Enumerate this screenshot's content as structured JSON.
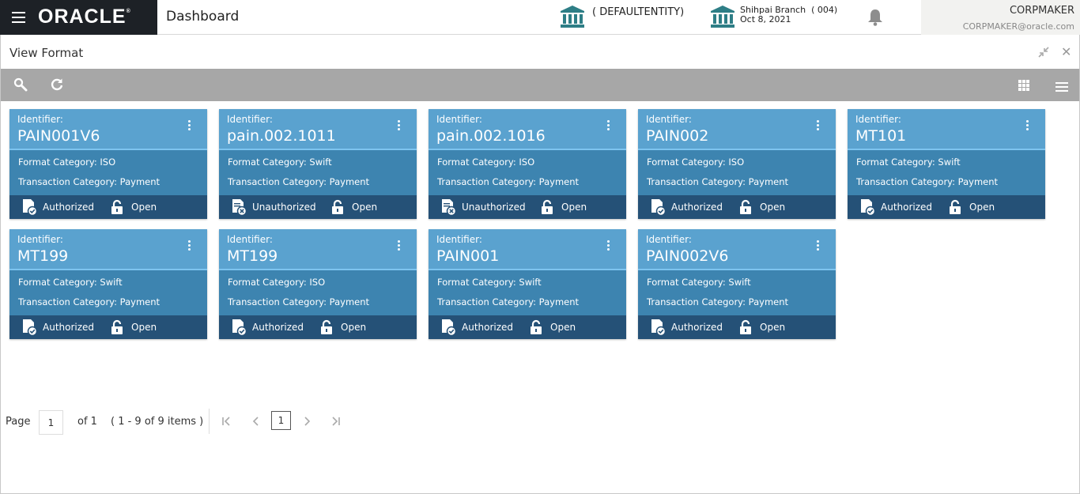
{
  "header": {
    "brand": "ORACLE",
    "title": "Dashboard",
    "entity": "( DEFAULTENTITY)",
    "branch_name": "Shihpai Branch",
    "branch_code": "( 004)",
    "branch_date": "Oct 8, 2021",
    "user_name": "CORPMAKER",
    "user_email": "CORPMAKER@oracle.com"
  },
  "window": {
    "title": "View Format"
  },
  "cards": [
    {
      "id_label": "Identifier:",
      "identifier": "PAIN001V6",
      "format_label": "Format Category:",
      "format": "ISO",
      "txn_label": "Transaction Category:",
      "txn": "Payment",
      "auth": "Authorized",
      "lock": "Open"
    },
    {
      "id_label": "Identifier:",
      "identifier": "pain.002.1011",
      "format_label": "Format Category:",
      "format": "Swift",
      "txn_label": "Transaction Category:",
      "txn": "Payment",
      "auth": "Unauthorized",
      "lock": "Open"
    },
    {
      "id_label": "Identifier:",
      "identifier": "pain.002.1016",
      "format_label": "Format Category:",
      "format": "ISO",
      "txn_label": "Transaction Category:",
      "txn": "Payment",
      "auth": "Unauthorized",
      "lock": "Open"
    },
    {
      "id_label": "Identifier:",
      "identifier": "PAIN002",
      "format_label": "Format Category:",
      "format": "ISO",
      "txn_label": "Transaction Category:",
      "txn": "Payment",
      "auth": "Authorized",
      "lock": "Open"
    },
    {
      "id_label": "Identifier:",
      "identifier": "MT101",
      "format_label": "Format Category:",
      "format": "Swift",
      "txn_label": "Transaction Category:",
      "txn": "Payment",
      "auth": "Authorized",
      "lock": "Open"
    },
    {
      "id_label": "Identifier:",
      "identifier": "MT199",
      "format_label": "Format Category:",
      "format": "Swift",
      "txn_label": "Transaction Category:",
      "txn": "Payment",
      "auth": "Authorized",
      "lock": "Open"
    },
    {
      "id_label": "Identifier:",
      "identifier": "MT199",
      "format_label": "Format Category:",
      "format": "ISO",
      "txn_label": "Transaction Category:",
      "txn": "Payment",
      "auth": "Authorized",
      "lock": "Open"
    },
    {
      "id_label": "Identifier:",
      "identifier": "PAIN001",
      "format_label": "Format Category:",
      "format": "Swift",
      "txn_label": "Transaction Category:",
      "txn": "Payment",
      "auth": "Authorized",
      "lock": "Open"
    },
    {
      "id_label": "Identifier:",
      "identifier": "PAIN002V6",
      "format_label": "Format Category:",
      "format": "Swift",
      "txn_label": "Transaction Category:",
      "txn": "Payment",
      "auth": "Authorized",
      "lock": "Open"
    }
  ],
  "pagination": {
    "page_label": "Page",
    "page_value": "1",
    "of_label": "of 1",
    "items_label": "( 1 - 9 of 9 items )",
    "current_page": "1"
  },
  "colors": {
    "card_head": "#5aa2cf",
    "card_body": "#3d84b0",
    "card_foot": "#255177",
    "toolbar": "#a7a7a7",
    "brand_bg": "#1d2126",
    "bank_icon": "#2e7e86"
  }
}
